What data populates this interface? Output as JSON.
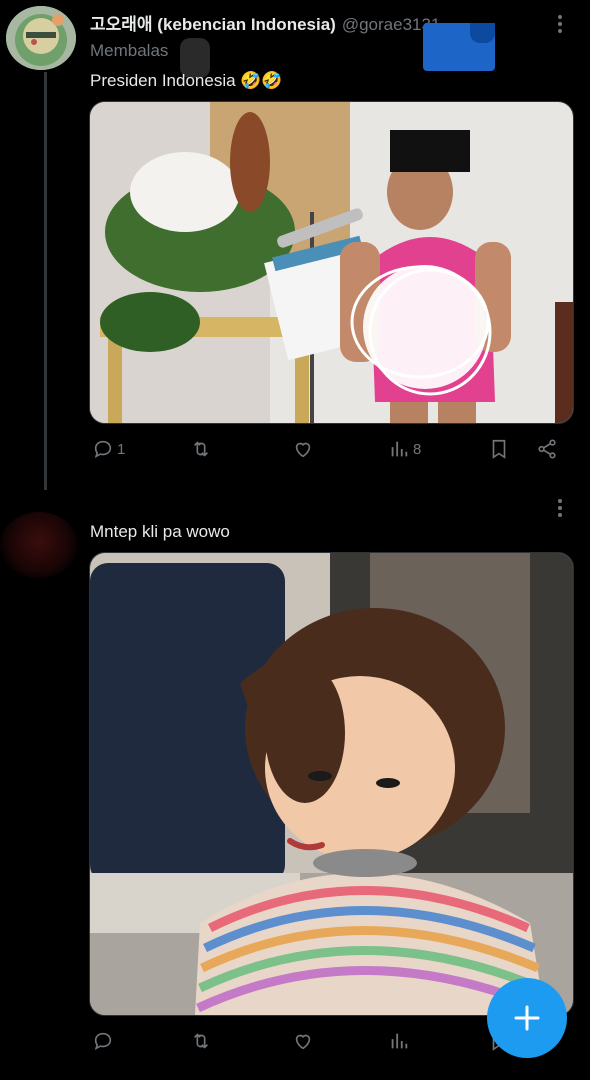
{
  "tweet1": {
    "author_name": "고오래애 (kebencian Indonesia)",
    "author_handle": "@gorae3131...",
    "replying_label": "Membalas",
    "text": "Presiden Indonesia 🤣🤣",
    "stats": {
      "replies": "1",
      "views": "8"
    }
  },
  "tweet2": {
    "text": "Mntep kli pa wowo"
  },
  "colors": {
    "accent": "#1d9bf0",
    "muted": "#71767b",
    "text": "#e7e9ea",
    "background": "#000000"
  },
  "icons": [
    "more-icon",
    "reply-icon",
    "retweet-icon",
    "like-icon",
    "views-icon",
    "bookmark-icon",
    "share-icon",
    "compose-plus-icon"
  ]
}
